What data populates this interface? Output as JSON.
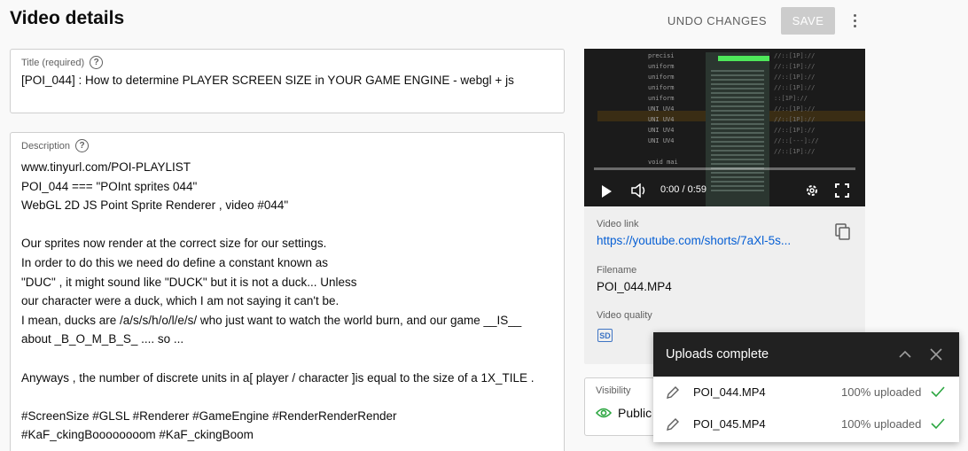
{
  "header": {
    "title": "Video details",
    "undo_label": "UNDO CHANGES",
    "save_label": "SAVE",
    "more_icon": "more-vert-icon"
  },
  "title_field": {
    "label": "Title (required)",
    "value": "[POI_044] : How to determine PLAYER SCREEN SIZE in YOUR GAME ENGINE - webgl + js"
  },
  "description_field": {
    "label": "Description",
    "lines": [
      "www.tinyurl.com/POI-PLAYLIST",
      "POI_044 === \"POInt sprites 044\"",
      "WebGL 2D JS Point Sprite Renderer , video #044\"",
      "",
      "Our sprites now render at the correct size for our settings.",
      "In order to do this we need do define a constant known as",
      "\"DUC\" , it might sound like \"DUCK\" but it is not a duck... Unless",
      "our character were a duck, which I am not saying it can't be.",
      "I mean, ducks are /a/s/s/h/o/l/e/s/ who just want to watch the world burn, and our game __IS__",
      "about _B_O_M_B_S_ .... so ...",
      "",
      "Anyways , the number of discrete units in a[ player / character ]is equal to the size of a 1X_TILE .",
      "",
      "#ScreenSize #GLSL #Renderer #GameEngine #RenderRenderRender",
      "#KaF_ckingBoooooooom #KaF_ckingBoom"
    ]
  },
  "video_panel": {
    "time": "0:00 / 0:59",
    "progress": 0,
    "link_label": "Video link",
    "link_value": "https://youtube.com/shorts/7aXl-5s...",
    "filename_label": "Filename",
    "filename_value": "POI_044.MP4",
    "quality_label": "Video quality",
    "quality_badge": "SD"
  },
  "visibility": {
    "label": "Visibility",
    "value": "Public"
  },
  "uploads": {
    "title": "Uploads complete",
    "items": [
      {
        "name": "POI_044.MP4",
        "status": "100% uploaded"
      },
      {
        "name": "POI_045.MP4",
        "status": "100% uploaded"
      }
    ]
  },
  "colors": {
    "link": "#065fd4",
    "success": "#2ba640",
    "accent_sd": "#3e74c4"
  }
}
